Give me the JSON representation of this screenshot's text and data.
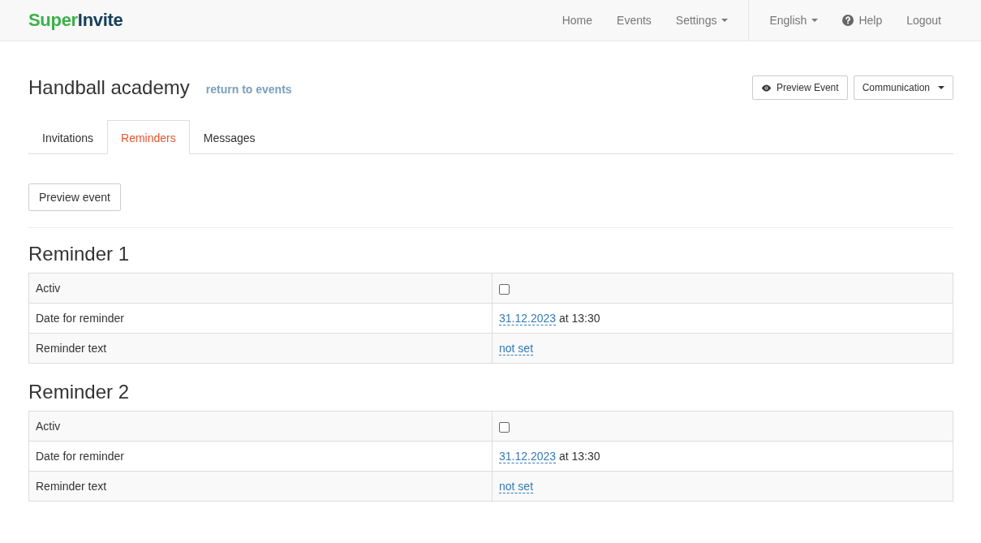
{
  "navbar": {
    "logo": {
      "part_1": "Super",
      "part_2": "Invite"
    },
    "left_items": [
      {
        "label": "Home",
        "dropdown": false
      },
      {
        "label": "Events",
        "dropdown": false
      },
      {
        "label": "Settings",
        "dropdown": true
      }
    ],
    "right_items": [
      {
        "label": "English",
        "kind": "dropdown"
      },
      {
        "label": "Help",
        "kind": "help"
      },
      {
        "label": "Logout",
        "kind": "plain"
      }
    ]
  },
  "page": {
    "title": "Handball academy",
    "back_link": "return to events",
    "actions": [
      {
        "label": "Preview Event",
        "kind": "preview"
      },
      {
        "label": "Communication",
        "kind": "dropdown"
      }
    ]
  },
  "tabs": [
    {
      "label": "Invitations",
      "selected": false
    },
    {
      "label": "Reminders",
      "selected": true
    },
    {
      "label": "Messages",
      "selected": false
    }
  ],
  "preview_button": "Preview event",
  "reminders": [
    {
      "title": "Reminder 1",
      "rows": [
        {
          "kind": "checkbox",
          "label": "Activ",
          "checked": false
        },
        {
          "kind": "date",
          "label": "Date for reminder",
          "date": "31.12.2023",
          "time": "at 13:30"
        },
        {
          "kind": "text",
          "label": "Reminder text",
          "value": "not set"
        }
      ]
    },
    {
      "title": "Reminder 2",
      "rows": [
        {
          "kind": "checkbox",
          "label": "Activ",
          "checked": false
        },
        {
          "kind": "date",
          "label": "Date for reminder",
          "date": "31.12.2023",
          "time": "at 13:30"
        },
        {
          "kind": "text",
          "label": "Reminder text",
          "value": "not set"
        }
      ]
    }
  ]
}
